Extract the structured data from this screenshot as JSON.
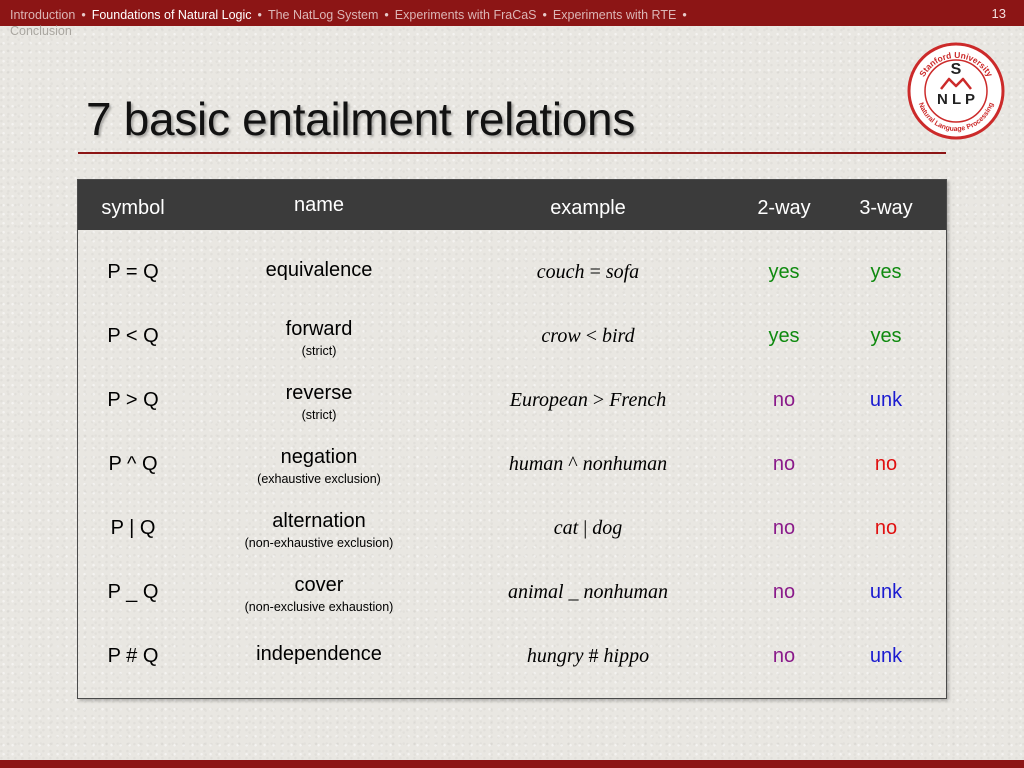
{
  "nav": {
    "items": [
      {
        "label": "Introduction",
        "active": false
      },
      {
        "label": "Foundations of Natural Logic",
        "active": true
      },
      {
        "label": "The NatLog System",
        "active": false
      },
      {
        "label": "Experiments with FraCaS",
        "active": false
      },
      {
        "label": "Experiments with RTE",
        "active": false
      }
    ],
    "second_line": "Conclusion",
    "separator": "•"
  },
  "page_number": "13",
  "logo": {
    "top_text": "Stanford University",
    "bottom_text": "Natural Language Processing",
    "letter_s": "S",
    "letters_nlp": "N L P",
    "color": "#cc2a2a"
  },
  "title": "7 basic entailment relations",
  "colors": {
    "accent": "#8c1515",
    "header_bg": "#3b3b3b",
    "yes": "#0f8a0f",
    "no": "#8a1a8a",
    "unk": "#1b1bd0",
    "no_3way": "#e01010"
  },
  "table": {
    "headers": {
      "symbol": "symbol",
      "name": "name",
      "example": "example",
      "two_way": "2-way",
      "three_way": "3-way"
    },
    "rows": [
      {
        "symbol": "P = Q",
        "name": "equivalence",
        "sub": "",
        "ex_a": "couch",
        "op": " = ",
        "ex_b": "sofa",
        "two_way": "yes",
        "three_way": "yes"
      },
      {
        "symbol": "P < Q",
        "name": "forward",
        "sub": "(strict)",
        "ex_a": "crow",
        "op": " < ",
        "ex_b": "bird",
        "two_way": "yes",
        "three_way": "yes"
      },
      {
        "symbol": "P > Q",
        "name": "reverse",
        "sub": "(strict)",
        "ex_a": "European",
        "op": " > ",
        "ex_b": "French",
        "two_way": "no",
        "three_way": "unk"
      },
      {
        "symbol": "P ^ Q",
        "name": "negation",
        "sub": "(exhaustive exclusion)",
        "ex_a": "human",
        "op": " ^ ",
        "ex_b": "nonhuman",
        "two_way": "no",
        "three_way": "no"
      },
      {
        "symbol": "P | Q",
        "name": "alternation",
        "sub": "(non-exhaustive exclusion)",
        "ex_a": "cat",
        "op": " | ",
        "ex_b": "dog",
        "two_way": "no",
        "three_way": "no"
      },
      {
        "symbol": "P _ Q",
        "name": "cover",
        "sub": "(non-exclusive exhaustion)",
        "ex_a": "animal",
        "op": " _ ",
        "ex_b": "nonhuman",
        "two_way": "no",
        "three_way": "unk"
      },
      {
        "symbol": "P # Q",
        "name": "independence",
        "sub": "",
        "ex_a": "hungry",
        "op": " # ",
        "ex_b": "hippo",
        "two_way": "no",
        "three_way": "unk"
      }
    ]
  }
}
